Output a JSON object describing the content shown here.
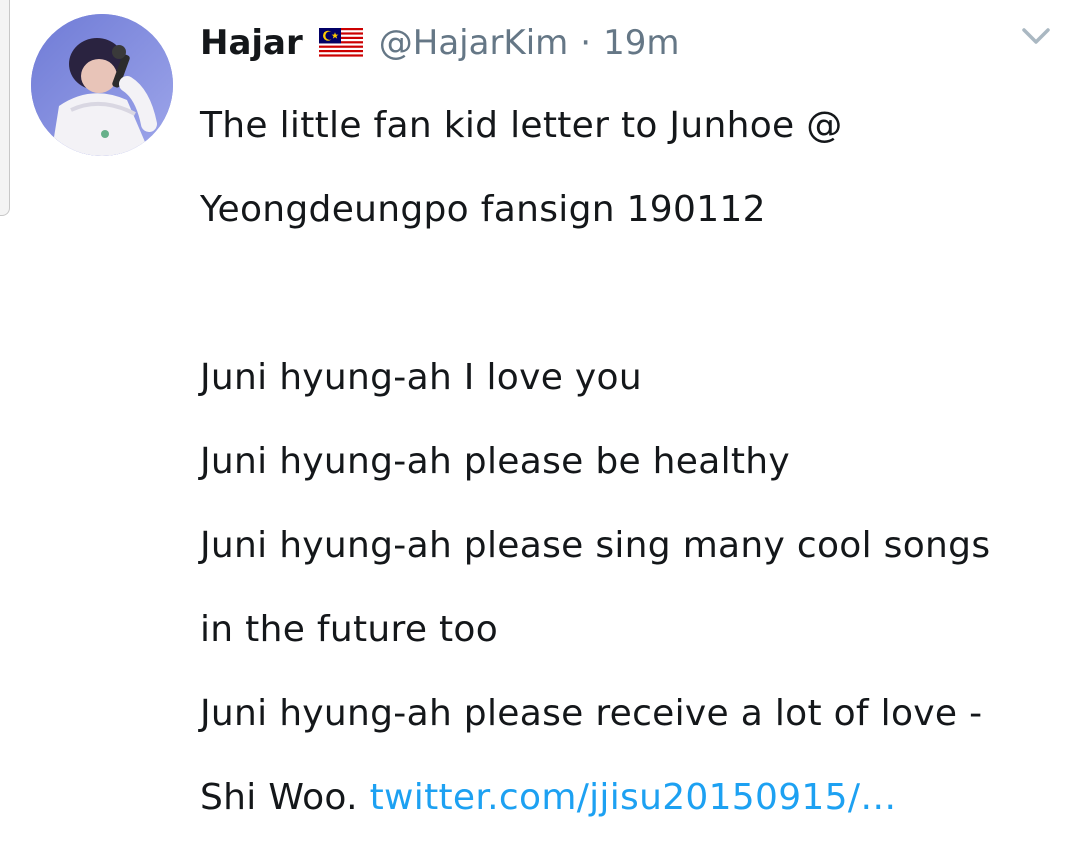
{
  "tweet": {
    "author": {
      "display_name": "Hajar",
      "flag_icon": "malaysia-flag-icon",
      "handle": "@HajarKim",
      "separator": "·",
      "timestamp": "19m"
    },
    "menu_icon": "chevron-down-icon",
    "text_lines": [
      "The little fan kid letter to Junhoe @",
      "Yeongdeungpo fansign 190112",
      "",
      "Juni hyung-ah I love you",
      "Juni hyung-ah please be healthy",
      "Juni hyung-ah please sing many cool songs",
      "in the future too",
      "Juni hyung-ah please receive a lot of love -"
    ],
    "final_line_text": "Shi Woo.",
    "link_text": "twitter.com/jjisu20150915/…"
  },
  "colors": {
    "text": "#14171a",
    "secondary": "#657786",
    "link": "#1da1f2"
  }
}
